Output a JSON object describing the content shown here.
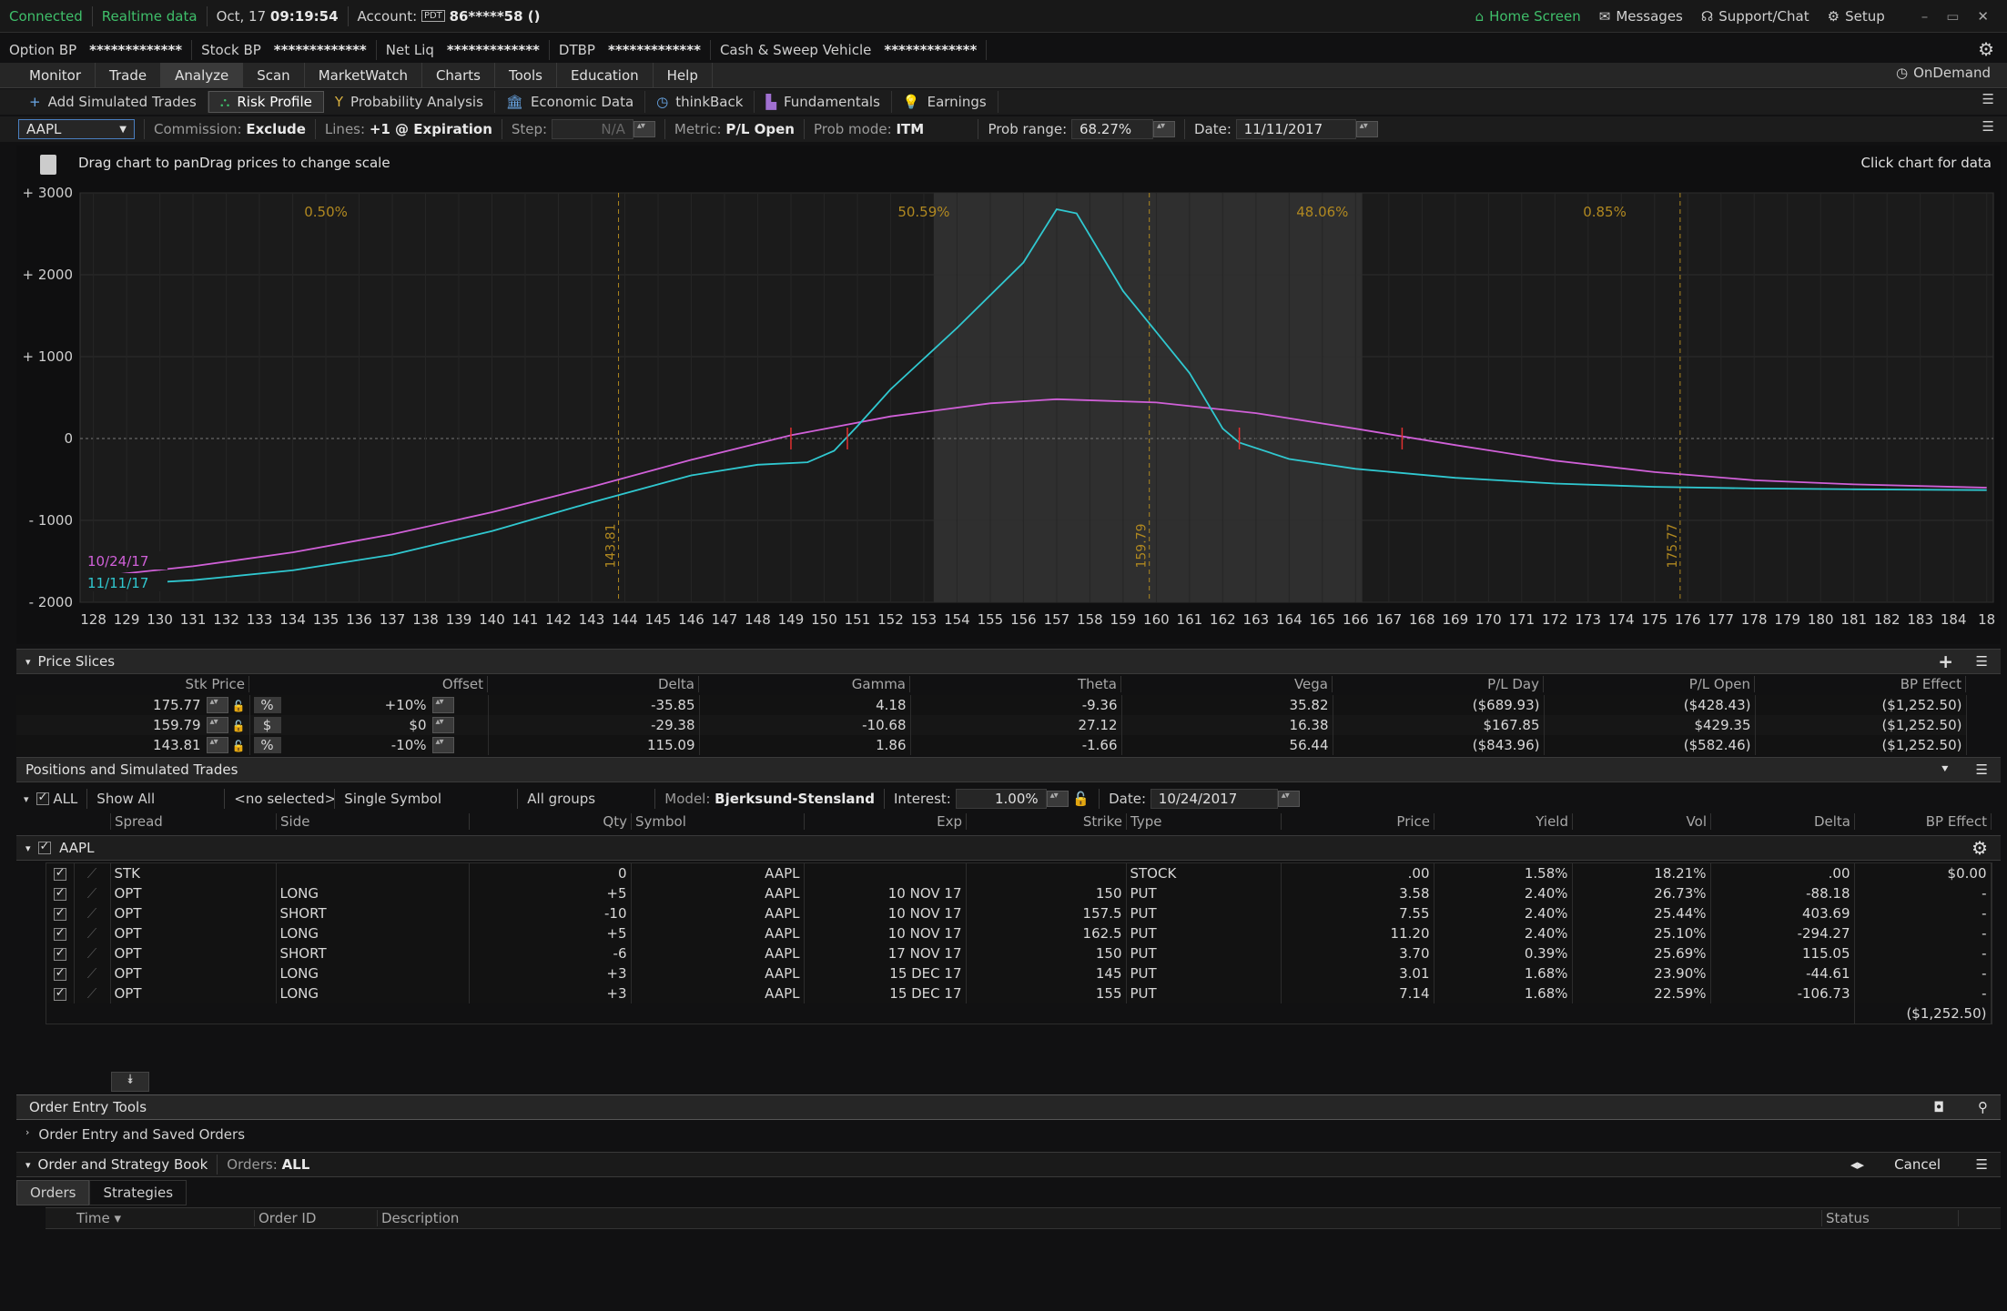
{
  "status": {
    "connected": "Connected",
    "realtime": "Realtime data",
    "date": "Oct, 17",
    "time": "09:19:54",
    "account_label": "Account:",
    "account_badge": "PDT",
    "account": "86*****58 ()"
  },
  "top_right": {
    "home": "Home Screen",
    "messages": "Messages",
    "support": "Support/Chat",
    "setup": "Setup"
  },
  "balances": [
    {
      "label": "Option BP",
      "value": "*************"
    },
    {
      "label": "Stock BP",
      "value": "*************"
    },
    {
      "label": "Net Liq",
      "value": "*************"
    },
    {
      "label": "DTBP",
      "value": "*************"
    },
    {
      "label": "Cash & Sweep Vehicle",
      "value": "*************"
    }
  ],
  "menu": [
    "Monitor",
    "Trade",
    "Analyze",
    "Scan",
    "MarketWatch",
    "Charts",
    "Tools",
    "Education",
    "Help"
  ],
  "ondemand": "OnDemand",
  "subtabs": [
    "Add Simulated Trades",
    "Risk Profile",
    "Probability Analysis",
    "Economic Data",
    "thinkBack",
    "Fundamentals",
    "Earnings"
  ],
  "controls": {
    "symbol": "AAPL",
    "commission_label": "Commission:",
    "commission": "Exclude",
    "lines_label": "Lines:",
    "lines": "+1 @ Expiration",
    "step_label": "Step:",
    "step": "N/A",
    "metric_label": "Metric:",
    "metric": "P/L Open",
    "probmode_label": "Prob mode:",
    "probmode": "ITM",
    "probrange_label": "Prob range:",
    "probrange": "68.27%",
    "date_label": "Date:",
    "date": "11/11/2017"
  },
  "chart_hint": {
    "left": "Drag chart to panDrag prices to change scale",
    "right": "Click chart for data"
  },
  "chart_data": {
    "type": "line",
    "x_ticks": [
      128,
      129,
      130,
      131,
      132,
      133,
      134,
      135,
      136,
      137,
      138,
      139,
      140,
      141,
      142,
      143,
      144,
      145,
      146,
      147,
      148,
      149,
      150,
      151,
      152,
      153,
      154,
      155,
      156,
      157,
      158,
      159,
      160,
      161,
      162,
      163,
      164,
      165,
      166,
      167,
      168,
      169,
      170,
      171,
      172,
      173,
      174,
      175,
      176,
      177,
      178,
      179,
      180,
      181,
      182,
      183,
      184,
      "18"
    ],
    "y_ticks": [
      "+ 3000",
      "+ 2000",
      "+ 1000",
      "0",
      "- 1000",
      "- 2000"
    ],
    "xlim": [
      127.6,
      185.2
    ],
    "ylim": [
      -2000,
      3000
    ],
    "probabilities": [
      "0.50%",
      "50.59%",
      "48.06%",
      "0.85%"
    ],
    "price_markers": [
      "143.81",
      "159.79",
      "175.77"
    ],
    "series": [
      {
        "name": "10/24/17",
        "color": "#d060d8",
        "x": [
          128,
          131,
          134,
          137,
          140,
          143,
          146,
          149,
          152,
          155,
          157,
          160,
          163,
          166,
          169,
          172,
          175,
          178,
          181,
          185
        ],
        "y": [
          -1690,
          -1560,
          -1390,
          -1170,
          -900,
          -590,
          -260,
          40,
          270,
          430,
          480,
          440,
          310,
          120,
          -80,
          -270,
          -410,
          -510,
          -560,
          -600
        ]
      },
      {
        "name": "11/11/17",
        "color": "#30c8d0",
        "x": [
          128,
          131,
          134,
          137,
          140,
          143,
          146,
          148,
          149.5,
          150.3,
          151,
          152,
          154,
          156,
          157,
          157.6,
          159,
          161,
          162,
          162.5,
          164,
          166,
          169,
          172,
          175,
          178,
          181,
          185
        ],
        "y": [
          -1800,
          -1730,
          -1610,
          -1420,
          -1130,
          -780,
          -450,
          -320,
          -290,
          -150,
          150,
          600,
          1350,
          2150,
          2800,
          2750,
          1800,
          800,
          120,
          -50,
          -250,
          -370,
          -480,
          -550,
          -590,
          -610,
          -620,
          -630
        ]
      }
    ]
  },
  "price_slices": {
    "title": "Price Slices",
    "headers": [
      "Stk Price",
      "Offset",
      "Delta",
      "Gamma",
      "Theta",
      "Vega",
      "P/L Day",
      "P/L Open",
      "BP Effect"
    ],
    "rows": [
      [
        "175.77",
        "%",
        "+10%",
        "-35.85",
        "4.18",
        "-9.36",
        "35.82",
        "($689.93)",
        "($428.43)",
        "($1,252.50)"
      ],
      [
        "159.79",
        "$",
        "$0",
        "-29.38",
        "-10.68",
        "27.12",
        "16.38",
        "$167.85",
        "$429.35",
        "($1,252.50)"
      ],
      [
        "143.81",
        "%",
        "-10%",
        "115.09",
        "1.86",
        "-1.66",
        "56.44",
        "($843.96)",
        "($582.46)",
        "($1,252.50)"
      ]
    ]
  },
  "positions": {
    "title": "Positions and Simulated Trades",
    "all": "ALL",
    "show": "Show All",
    "noselected": "<no selected>",
    "single": "Single Symbol",
    "groups": "All groups",
    "model_label": "Model:",
    "model": "Bjerksund-Stensland",
    "interest_label": "Interest:",
    "interest": "1.00%",
    "date_label": "Date:",
    "date": "10/24/2017",
    "headers": [
      "Spread",
      "Side",
      "Qty",
      "Symbol",
      "Exp",
      "Strike",
      "Type",
      "Price",
      "Yield",
      "Vol",
      "Delta",
      "BP Effect"
    ],
    "group": "AAPL",
    "rows": [
      [
        "STK",
        "",
        "0",
        "AAPL",
        "",
        "",
        "STOCK",
        ".00",
        "1.58%",
        "18.21%",
        ".00",
        "$0.00"
      ],
      [
        "OPT",
        "LONG",
        "+5",
        "AAPL",
        "10 NOV 17",
        "150",
        "PUT",
        "3.58",
        "2.40%",
        "26.73%",
        "-88.18",
        "-"
      ],
      [
        "OPT",
        "SHORT",
        "-10",
        "AAPL",
        "10 NOV 17",
        "157.5",
        "PUT",
        "7.55",
        "2.40%",
        "25.44%",
        "403.69",
        "-"
      ],
      [
        "OPT",
        "LONG",
        "+5",
        "AAPL",
        "10 NOV 17",
        "162.5",
        "PUT",
        "11.20",
        "2.40%",
        "25.10%",
        "-294.27",
        "-"
      ],
      [
        "OPT",
        "SHORT",
        "-6",
        "AAPL",
        "17 NOV 17",
        "150",
        "PUT",
        "3.70",
        "0.39%",
        "25.69%",
        "115.05",
        "-"
      ],
      [
        "OPT",
        "LONG",
        "+3",
        "AAPL",
        "15 DEC 17",
        "145",
        "PUT",
        "3.01",
        "1.68%",
        "23.90%",
        "-44.61",
        "-"
      ],
      [
        "OPT",
        "LONG",
        "+3",
        "AAPL",
        "15 DEC 17",
        "155",
        "PUT",
        "7.14",
        "1.68%",
        "22.59%",
        "-106.73",
        "-"
      ]
    ],
    "total": "($1,252.50)"
  },
  "order_entry": {
    "title": "Order Entry Tools",
    "saved": "Order Entry and Saved Orders",
    "book": "Order and Strategy Book",
    "orders_label": "Orders:",
    "orders": "ALL",
    "cancel": "Cancel",
    "tabs": [
      "Orders",
      "Strategies"
    ],
    "cols": [
      "Time",
      "Order ID",
      "Description",
      "Status"
    ]
  }
}
